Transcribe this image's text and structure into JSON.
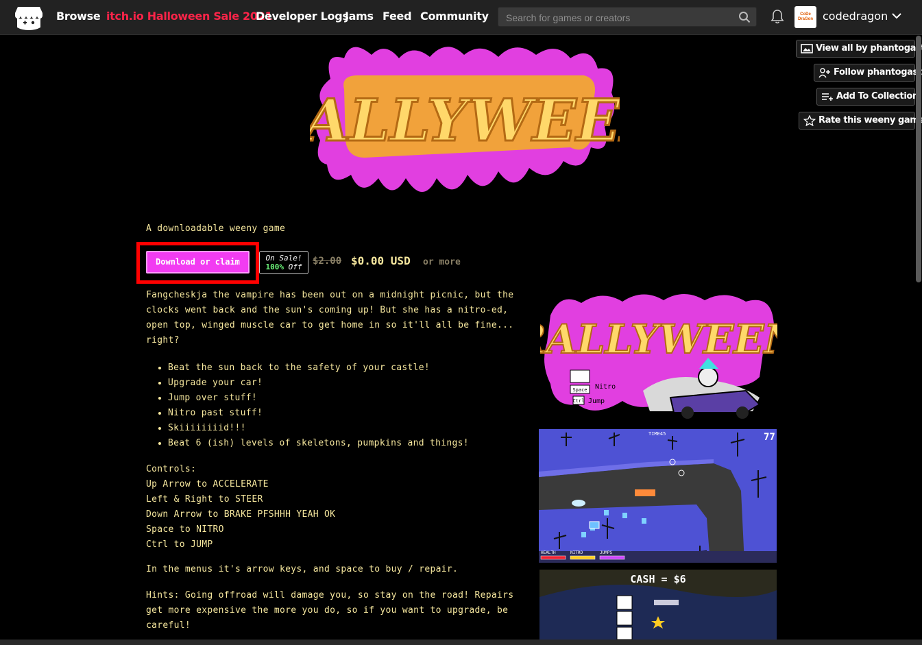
{
  "nav": {
    "links": [
      "Browse",
      "itch.io Halloween Sale 2021",
      "Developer Logs",
      "Jams",
      "Feed",
      "Community"
    ],
    "search_placeholder": "Search for games or creators",
    "username": "codedragon",
    "avatar_text": "CoDe DraGon"
  },
  "actions": {
    "view_all": "View all by phantogast",
    "follow": "Follow phantogast",
    "collection": "Add To Collection",
    "rate": "Rate this weeny game"
  },
  "game": {
    "banner_title": "RALLYWEEN",
    "tagline": "A downloadable weeny game",
    "download_label": "Download or claim",
    "sale_line1": "On Sale!",
    "sale_pct": "100%",
    "sale_off": "Off",
    "old_price": "$2.00",
    "new_price": "$0.00 USD",
    "price_suffix": "or more",
    "description": "Fangcheskja the vampire has been out on a midnight picnic, but the clocks went back and the sun's coming up! But she has a nitro-ed, open top, winged muscle car to get home in so it'll all be fine... right?",
    "features": [
      "Beat the sun back to the safety of your castle!",
      "Upgrade your car!",
      "Jump over stuff!",
      "Nitro past stuff!",
      "Skiiiiiiiid!!!",
      "Beat 6 (ish) levels of skeletons, pumpkins and things!"
    ],
    "controls": [
      "Controls:",
      "Up Arrow to ACCELERATE",
      "Left & Right to STEER",
      "Down Arrow to BRAKE PFSHHH YEAH OK",
      "Space to NITRO",
      "Ctrl to JUMP"
    ],
    "menus_note": "In the menus it's arrow keys, and space to buy / repair.",
    "hints": "Hints: Going offroad will damage you, so stay on the road! Repairs get more expensive the more you do, so if you want to upgrade, be careful!"
  },
  "screenshots": {
    "thumb_nitro": "Nitro",
    "thumb_jump": "Jump",
    "thumb_space": "Space",
    "thumb_ctrl": "Ctrl",
    "hud_timer": "TIME45",
    "hud_counter": "77",
    "hud_health": "HEALTH",
    "hud_nitro": "NITRO",
    "hud_jumps": "JUMPS",
    "cash": "CASH = $6"
  }
}
